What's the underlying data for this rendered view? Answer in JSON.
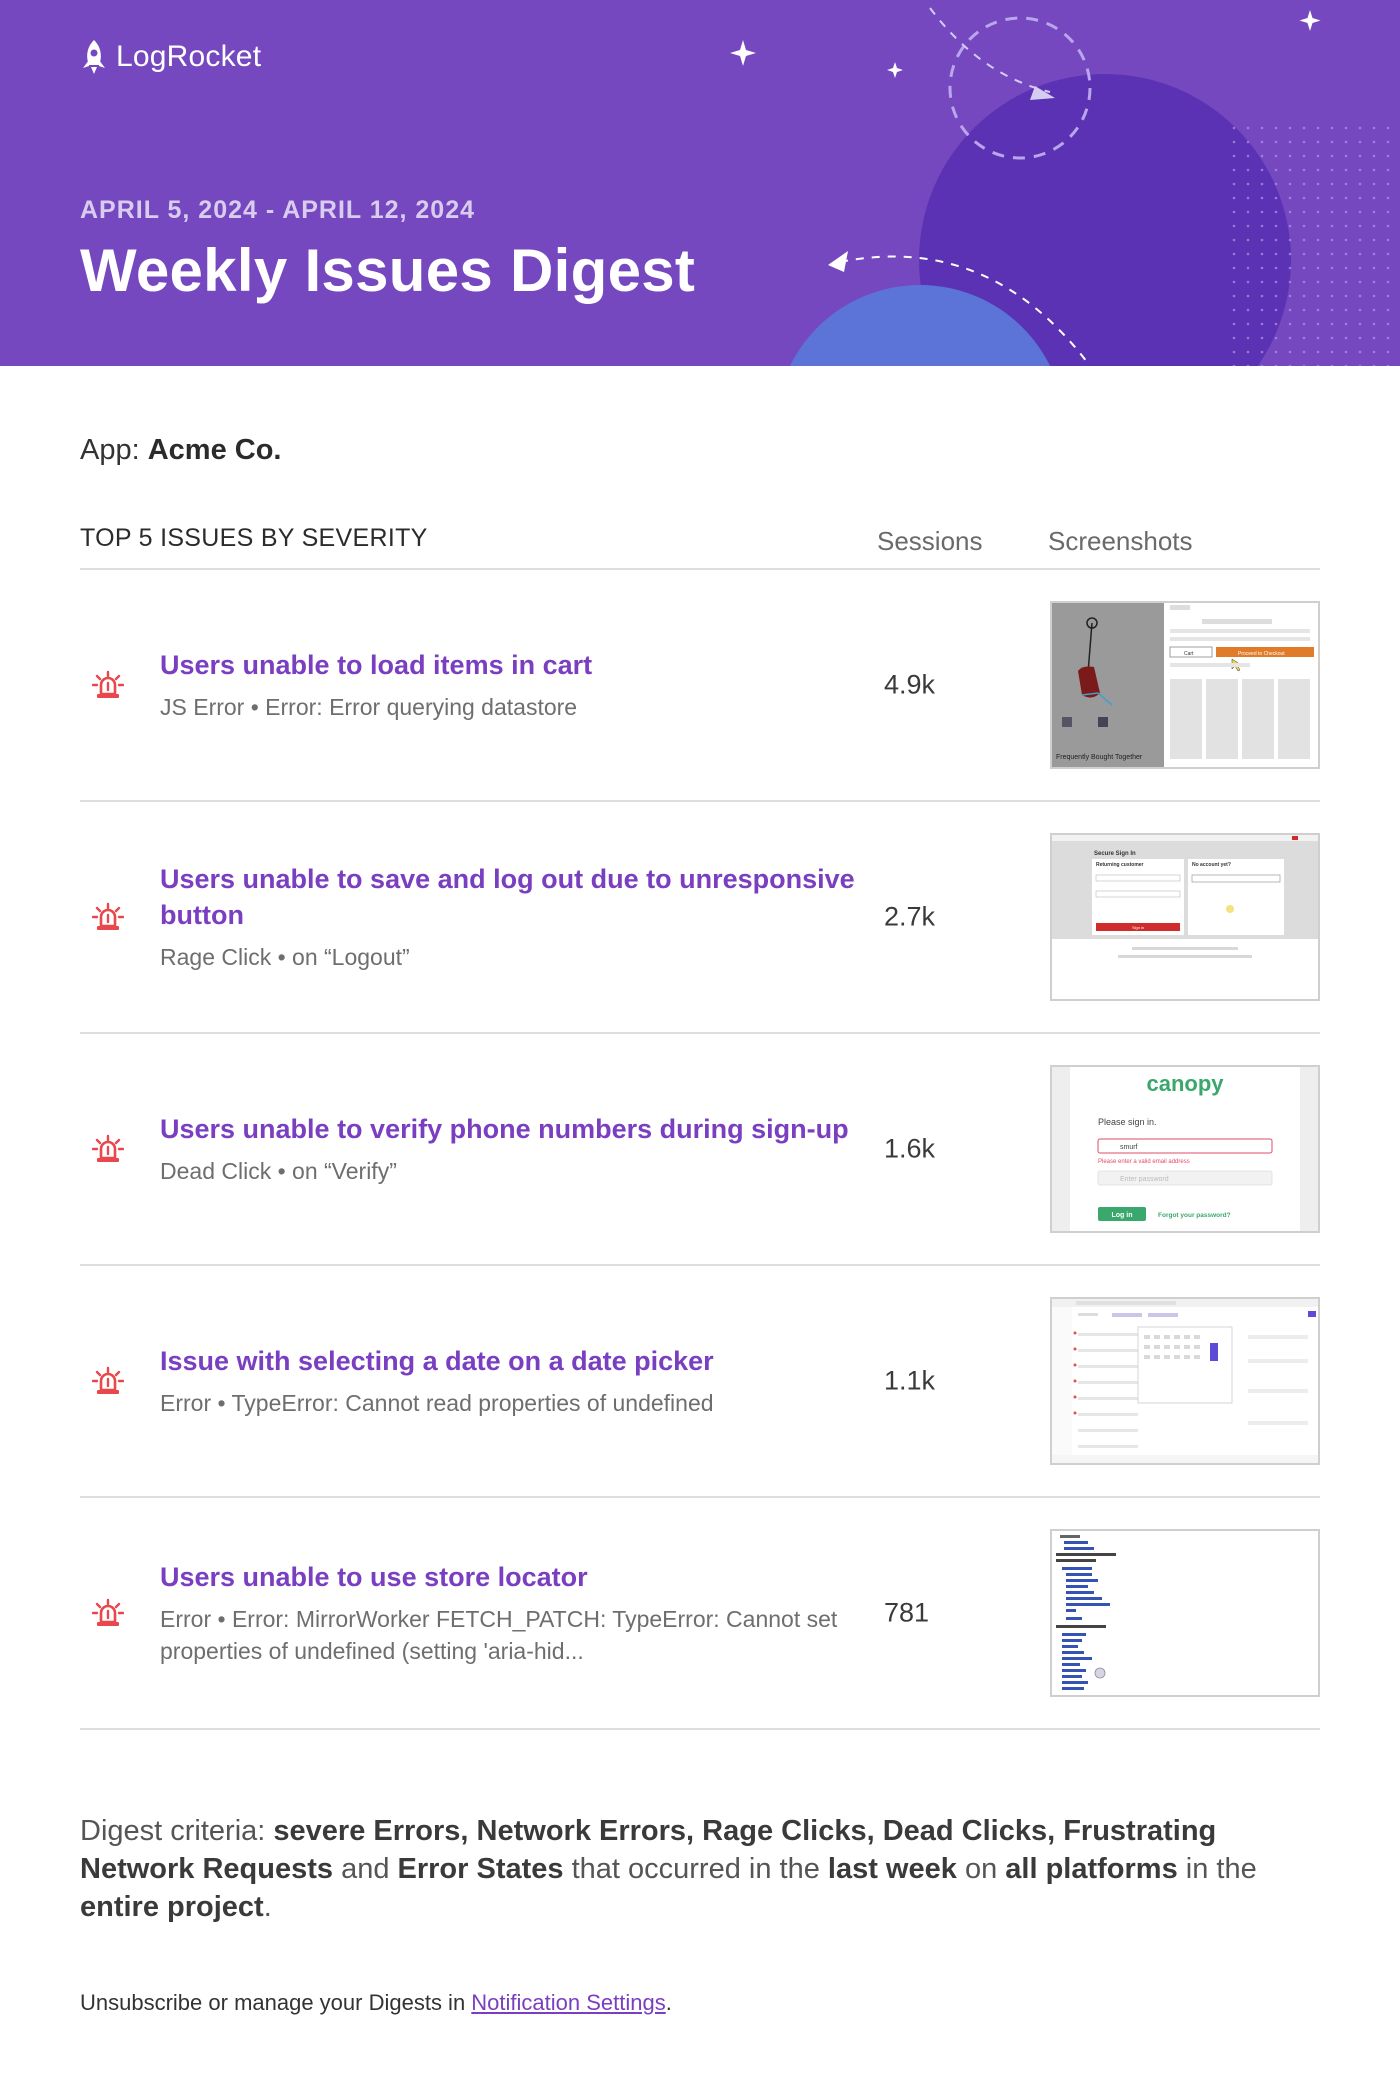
{
  "header": {
    "logo_text": "LogRocket",
    "date_range": "APRIL 5, 2024 - APRIL 12, 2024",
    "title": "Weekly Issues Digest",
    "background_color": "#7648c0"
  },
  "app": {
    "label": "App: ",
    "name": "Acme Co."
  },
  "table": {
    "title": "TOP 5 ISSUES BY SEVERITY",
    "col_sessions": "Sessions",
    "col_screenshots": "Screenshots"
  },
  "issues": [
    {
      "title": "Users unable to load items in cart",
      "subtitle": "JS Error • Error: Error querying datastore",
      "sessions": "4.9k",
      "icon": "alarm-siren-icon",
      "screenshot": {
        "text_1": "Cart",
        "text_2": "Proceed to Checkout",
        "text_3": "Frequently Bought Together"
      }
    },
    {
      "title": "Users unable to save and log out due to unresponsive button",
      "subtitle": "Rage Click • on “Logout”",
      "sessions": "2.7k",
      "icon": "alarm-siren-icon",
      "screenshot": {
        "text_1": "Secure Sign In",
        "text_2": "Returning customer",
        "text_3": "No account yet?",
        "text_4": "Sign in"
      }
    },
    {
      "title": "Users unable to verify phone numbers during sign-up",
      "subtitle": "Dead Click • on “Verify”",
      "sessions": "1.6k",
      "icon": "alarm-siren-icon",
      "screenshot": {
        "brand": "canopy",
        "text_1": "Please sign in.",
        "text_2": "smurf",
        "text_3": "Please enter a valid email address",
        "text_4": "Enter password",
        "text_5": "Log in",
        "text_6": "Forgot your password?"
      }
    },
    {
      "title": "Issue with selecting a date on a date picker",
      "subtitle": "Error • TypeError: Cannot read properties of undefined",
      "sessions": "1.1k",
      "icon": "alarm-siren-icon",
      "screenshot": {}
    },
    {
      "title": "Users unable to use store locator",
      "subtitle": "Error • Error: MirrorWorker FETCH_PATCH: TypeError: Cannot set properties of undefined (setting 'aria-hid...",
      "sessions": "781",
      "icon": "alarm-siren-icon",
      "screenshot": {}
    }
  ],
  "criteria": {
    "prefix": "Digest criteria: ",
    "types": "severe Errors, Network Errors, Rage Clicks, Dead Clicks, Frustrating Network Requests",
    "and": " and ",
    "types_2": "Error States",
    "mid": " that occurred in the ",
    "period": "last week",
    "on": " on ",
    "platforms": "all platforms",
    "in": " in the ",
    "scope": "entire project",
    "end": "."
  },
  "footer": {
    "text": "Unsubscribe or manage your Digests in ",
    "link": "Notification Settings",
    "end": "."
  },
  "colors": {
    "accent": "#7a3fc1",
    "siren": "#e8474b"
  }
}
